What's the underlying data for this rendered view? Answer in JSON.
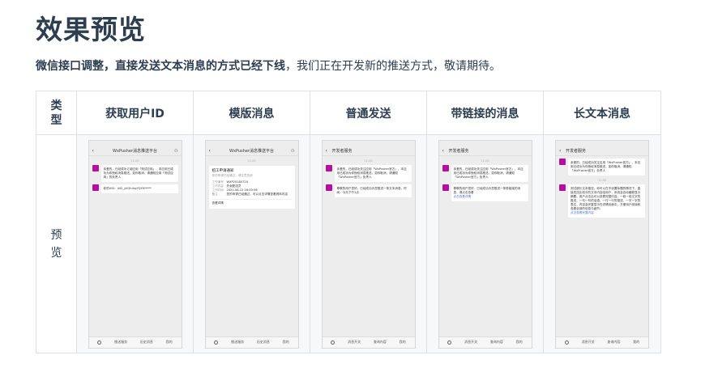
{
  "title": "效果预览",
  "notice": {
    "bold": "微信接口调整，直接发送文本消息的方式已经下线",
    "rest": "，我们正在开发新的推送方式，敬请期待。"
  },
  "table": {
    "headers": [
      "类型",
      "获取用户ID",
      "模版消息",
      "普通发送",
      "带链接的消息",
      "长文本消息"
    ],
    "row_label": "预览"
  },
  "phones": {
    "uid": {
      "header": "WxPusher消息推送平台",
      "time": "11:00",
      "msg1": "亲爱的，已经成功订阅应用「测试应用」，本应用已成功为你授权消息推送，如你取消，请通知应用「测试应用」的负责人",
      "msg2": "你的UID：UID_yKQh4rgYQYHl****",
      "bottom": [
        "推送服务",
        "历史消息",
        "我的"
      ]
    },
    "template": {
      "header": "WxPusher消息推送平台",
      "time": "11:00",
      "card_title": "招工申请通知",
      "card_sub": "你的申请已经通过，请注意查收",
      "rows": [
        [
          "工作编号",
          "WXP20180720"
        ],
        [
          "工作内容",
          "外卖配送员"
        ],
        [
          "工作时间",
          "2021-06-12 18:00:56"
        ],
        [
          "备注",
          "您的申请已经通过，可以点击详情查看具体内容"
        ]
      ],
      "card_footer": "查看详情",
      "bottom": [
        "推送服务",
        "历史消息",
        "我的"
      ]
    },
    "normal": {
      "header": "开发者服务",
      "time": "11:00",
      "msg1": "亲爱的，已经成功关注应用「WxPusher官方」，本应用已成功为你授权消息推送，如你取消，请通知「WxPusher官方」负责人",
      "msg2": "尊敬的用户您好，已经成功为您推送一条文本消息，时间：今天下午3点",
      "bottom": [
        "消息开关",
        "查询内容",
        "我的"
      ]
    },
    "link": {
      "header": "开发者服务",
      "time": "11:00",
      "msg1": "亲爱的，已经成功关注应用「WxPusher官方」，本应用已成功为你授权消息推送，如你取消，请通知「WxPusher官方」负责人",
      "msg2": "尊敬的用户您好，已经成功为您推送一条带链接的消息，请点击查看",
      "link_text": "点击查看详情",
      "bottom": [
        "消息开关",
        "查询内容",
        "我的"
      ]
    },
    "long": {
      "header": "开发者服务",
      "time": "11:00",
      "msg1": "亲爱的，已经成功关注应用「WxPusher官方」，本应用已成功为你授权消息推送，如你取消，请通知「WxPusher官方」负责人",
      "msg2": "测试超长文本推送，你可以在不设置标题的情况下，直接发送比较长的文本内容给用户，系统会自动截断显示摘要，用户点击后可以查看完整内容。一段一段文字的推送，一句一句的话语，一行一行的描述，一字一字的表达，内容会完整显示在详情页面中，方便用户阅读和查看全部的信息与细节。",
      "link_text": "点击查看完整内容",
      "bottom": [
        "消息开关",
        "查询内容",
        "我的"
      ]
    }
  },
  "colors": {
    "accent": "#b0109b",
    "link": "#4a6fd8",
    "text": "#2c3e50"
  }
}
